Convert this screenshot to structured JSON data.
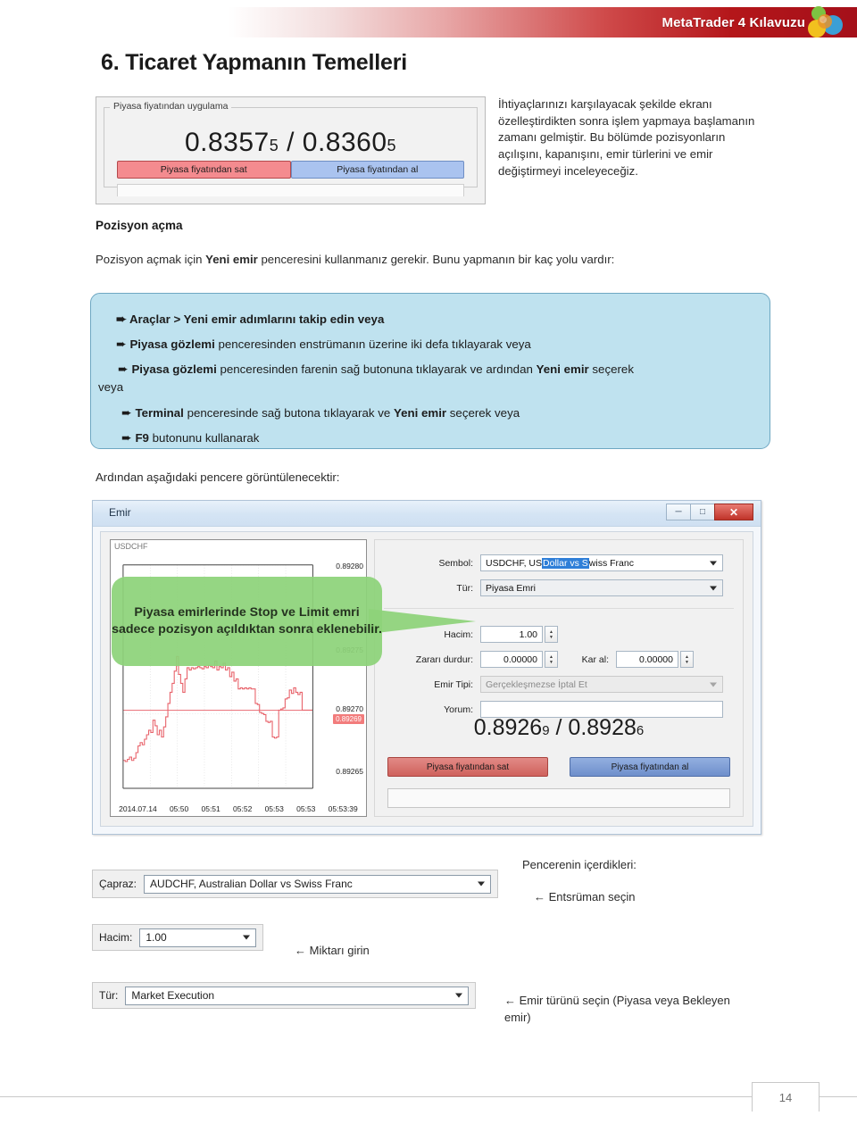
{
  "banner": {
    "title": "MetaTrader 4 Kılavuzu",
    "logo_icon": "metatrader-logo-icon",
    "accent_color": "#b4161a"
  },
  "page": {
    "title": "6. Ticaret Yapmanın Temelleri",
    "number": "14"
  },
  "price_panel": {
    "legend": "Piyasa fiyatından uygulama",
    "bid": "0.8357",
    "bid_sub": "5",
    "separator": "/",
    "ask": "0.8360",
    "ask_sub": "5",
    "sell_label": "Piyasa fiyatından sat",
    "buy_label": "Piyasa fiyatından al",
    "sell_color": "#f48b8f",
    "buy_color": "#aac3ef"
  },
  "intro_paragraph": "İhtiyaçlarınızı karşılayacak şekilde ekranı özelleştirdikten sonra işlem yapmaya başlamanın zamanı gelmiştir. Bu bölümde pozisyonların açılışını, kapanışını, emir türlerini ve emir değiştirmeyi inceleyeceğiz.",
  "section": {
    "heading": "Pozisyon açma",
    "paragraph_a": "Pozisyon açmak için ",
    "paragraph_b": "Yeni emir",
    "paragraph_c": " penceresini kullanmanız gerekir. Bunu yapmanın bir kaç yolu vardır:"
  },
  "bullet_box": {
    "background_color": "#bfe2ef",
    "arrow": "➨",
    "items": [
      {
        "bold1": "Araçlar > Yeni emir adımlarını takip edin veya",
        "rest1": ""
      },
      {
        "bold1": "Piyasa gözlemi",
        "rest1": " penceresinden enstrümanın üzerine iki defa tıklayarak veya"
      },
      {
        "bold1": "Piyasa gözlemi",
        "rest1": " penceresinden farenin sağ butonuna tıklayarak ve ardından ",
        "bold2": "Yeni emir",
        "rest2": " seçerek"
      },
      {
        "bold1": "Terminal",
        "rest1": " penceresinde sağ butona tıklayarak ve ",
        "bold2": "Yeni emir",
        "rest2": " seçerek veya"
      },
      {
        "bold1": "F9",
        "rest1": " butonunu kullanarak"
      }
    ],
    "wrap_word": "veya"
  },
  "caption_1": "Ardından aşağıdaki pencere görüntülenecektir:",
  "emir_window": {
    "title": "Emir",
    "minimize_icon": "minimize-icon",
    "maximize_icon": "maximize-icon",
    "close_icon": "close-icon",
    "chart_symbol": "USDCHF",
    "fields": [
      {
        "label": "Sembol:",
        "value_pre": "USDCHF, US ",
        "value_sel": "Dollar vs S",
        "value_post": "wiss Franc"
      },
      {
        "label": "Tür:",
        "value": "Piyasa Emri"
      },
      {
        "label": "Hacim:",
        "value": "1.00"
      },
      {
        "label": "Zararı durdur:",
        "value": "0.00000"
      },
      {
        "label": "Kar al:",
        "value": "0.00000"
      },
      {
        "label": "Emir Tipi:",
        "value": "Gerçekleşmezse İptal Et"
      },
      {
        "label": "Yorum:",
        "value": ""
      }
    ],
    "bid": "0.8926",
    "bid_sub": "9",
    "separator": "/",
    "ask": "0.8928",
    "ask_sub": "6",
    "sell_label": "Piyasa fiyatından sat",
    "buy_label": "Piyasa fiyatından al"
  },
  "callout": {
    "text": "Piyasa emirlerinde Stop ve Limit emri sadece pozisyon açıldıktan sonra eklenebilir.",
    "color": "#8ed37a"
  },
  "chart_data": {
    "type": "line",
    "title": "USDCHF",
    "xlabel": "",
    "ylabel": "",
    "x_ticks": [
      "2014.07.14",
      "05:50",
      "05:51",
      "05:52",
      "05:53",
      "05:53",
      "05:53:39"
    ],
    "y_ticks": [
      "0.89280",
      "0.89275",
      "0.89270",
      "0.89265"
    ],
    "ylim": [
      0.89262,
      0.89282
    ],
    "grid": true,
    "legend": "none",
    "line_color": "#e8636b",
    "current_price_label": "0.89269",
    "series": [
      {
        "name": "USDCHF bid",
        "values": [
          0.892645,
          0.892644,
          0.892646,
          0.892648,
          0.892645,
          0.892647,
          0.892652,
          0.892658,
          0.892661,
          0.892659,
          0.892664,
          0.892668,
          0.892672,
          0.89267,
          0.892681,
          0.892676,
          0.892668,
          0.892672,
          0.892666,
          0.892675,
          0.892684,
          0.892696,
          0.892706,
          0.892714,
          0.892725,
          0.892738,
          0.892722,
          0.892714,
          0.892706,
          0.892718,
          0.892728,
          0.892726,
          0.892728,
          0.892727,
          0.892728,
          0.892729,
          0.892728,
          0.892727,
          0.892729,
          0.892728,
          0.89273,
          0.892729,
          0.892728,
          0.892734,
          0.892726,
          0.892729,
          0.892728,
          0.892732,
          0.892726,
          0.892728,
          0.89272,
          0.892724,
          0.892716,
          0.892718,
          0.892709,
          0.89271,
          0.892709,
          0.89271,
          0.892709,
          0.89271,
          0.892709,
          0.892709,
          0.892696,
          0.892695,
          0.892688,
          0.892687,
          0.892686,
          0.89268,
          0.892679,
          0.89268,
          0.892666,
          0.892665,
          0.892666,
          0.89269,
          0.892691,
          0.892692,
          0.8927,
          0.892701,
          0.892708,
          0.892705,
          0.89271,
          0.892706,
          0.892704,
          0.892706,
          0.89269,
          0.89269,
          0.89269,
          0.89269,
          0.89269,
          0.89269
        ]
      }
    ]
  },
  "bottom_widgets": {
    "capraz": {
      "label": "Çapraz:",
      "value": "AUDCHF, Australian Dollar vs Swiss Franc",
      "caret_icon": "chevron-down-icon"
    },
    "hacim": {
      "label": "Hacim:",
      "value": "1.00",
      "caret_icon": "chevron-down-icon"
    },
    "tur": {
      "label": "Tür:",
      "value": "Market Execution",
      "caret_icon": "chevron-down-icon"
    }
  },
  "annotations": {
    "heading": "Pencerenin içerdikleri:",
    "enstruman": "← Entsrüman seçin",
    "miktar": "← Miktarı girin",
    "emirturu": "← Emir türünü seçin (Piyasa veya Bekleyen emir)"
  }
}
